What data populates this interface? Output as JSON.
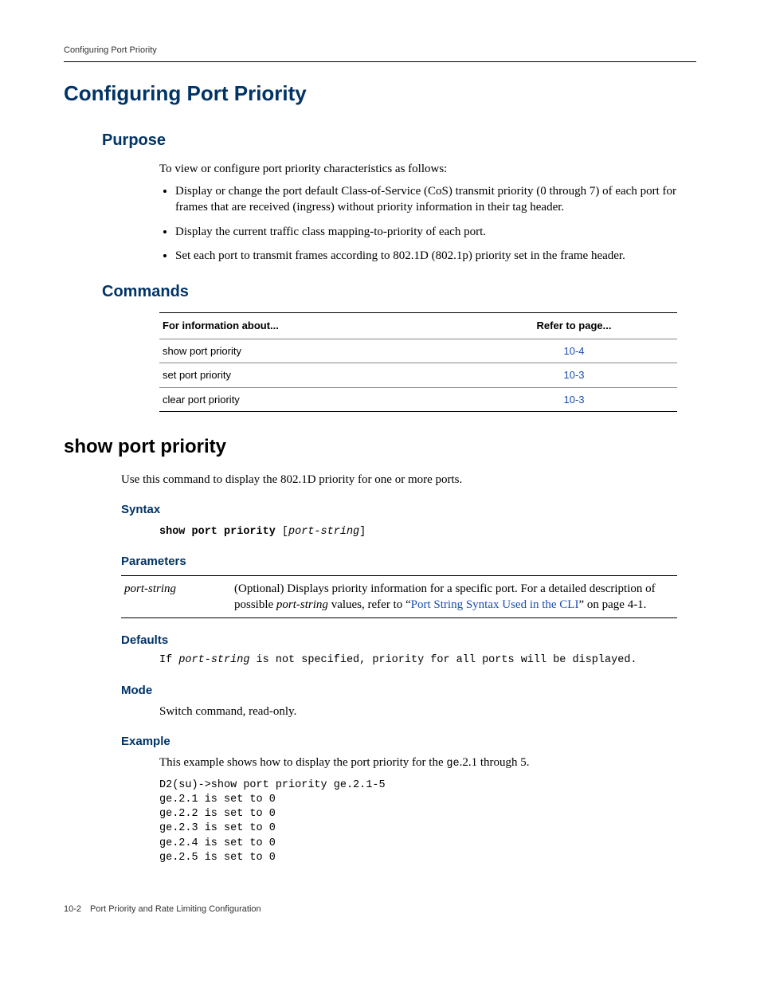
{
  "running_head": "Configuring Port Priority",
  "title": "Configuring Port Priority",
  "purpose": {
    "heading": "Purpose",
    "intro": "To view or configure port priority characteristics as follows:",
    "bullets": [
      "Display or change the port default Class-of-Service (CoS) transmit priority (0 through 7) of each port for frames that are received (ingress) without priority information in their tag header.",
      "Display the current traffic class mapping-to-priority of each port.",
      "Set each port to transmit frames according to 802.1D (802.1p) priority set in the frame header."
    ]
  },
  "commands": {
    "heading": "Commands",
    "col1": "For information about...",
    "col2": "Refer to page...",
    "rows": [
      {
        "about": "show port priority",
        "page": "10-4"
      },
      {
        "about": "set port priority",
        "page": "10-3"
      },
      {
        "about": "clear port priority",
        "page": "10-3"
      }
    ]
  },
  "show_port_priority": {
    "heading": "show port priority",
    "desc": "Use this command to display the 802.1D priority for one or more ports.",
    "syntax": {
      "heading": "Syntax",
      "cmd_bold": "show port priority",
      "cmd_optional_open": " [",
      "cmd_arg": "port-string",
      "cmd_optional_close": "]"
    },
    "parameters": {
      "heading": "Parameters",
      "name": "port-string",
      "desc_pre": "(Optional) Displays priority information for a specific port. For a detailed description of possible ",
      "desc_italic": "port-string",
      "desc_mid": " values, refer to “",
      "desc_link": "Port String Syntax Used in the CLI",
      "desc_post": "” on page 4-1."
    },
    "defaults": {
      "heading": "Defaults",
      "text_pre": "If ",
      "text_arg": "port-string",
      "text_post": " is not specified, priority for all ports will be displayed."
    },
    "mode": {
      "heading": "Mode",
      "text": "Switch command, read-only."
    },
    "example": {
      "heading": "Example",
      "intro_pre": "This example shows how to display the port priority for the ",
      "intro_code": "ge",
      "intro_post": ".2.1 through 5.",
      "output": "D2(su)->show port priority ge.2.1-5\nge.2.1 is set to 0\nge.2.2 is set to 0\nge.2.3 is set to 0\nge.2.4 is set to 0\nge.2.5 is set to 0"
    }
  },
  "footer": "10-2 Port Priority and Rate Limiting Configuration"
}
